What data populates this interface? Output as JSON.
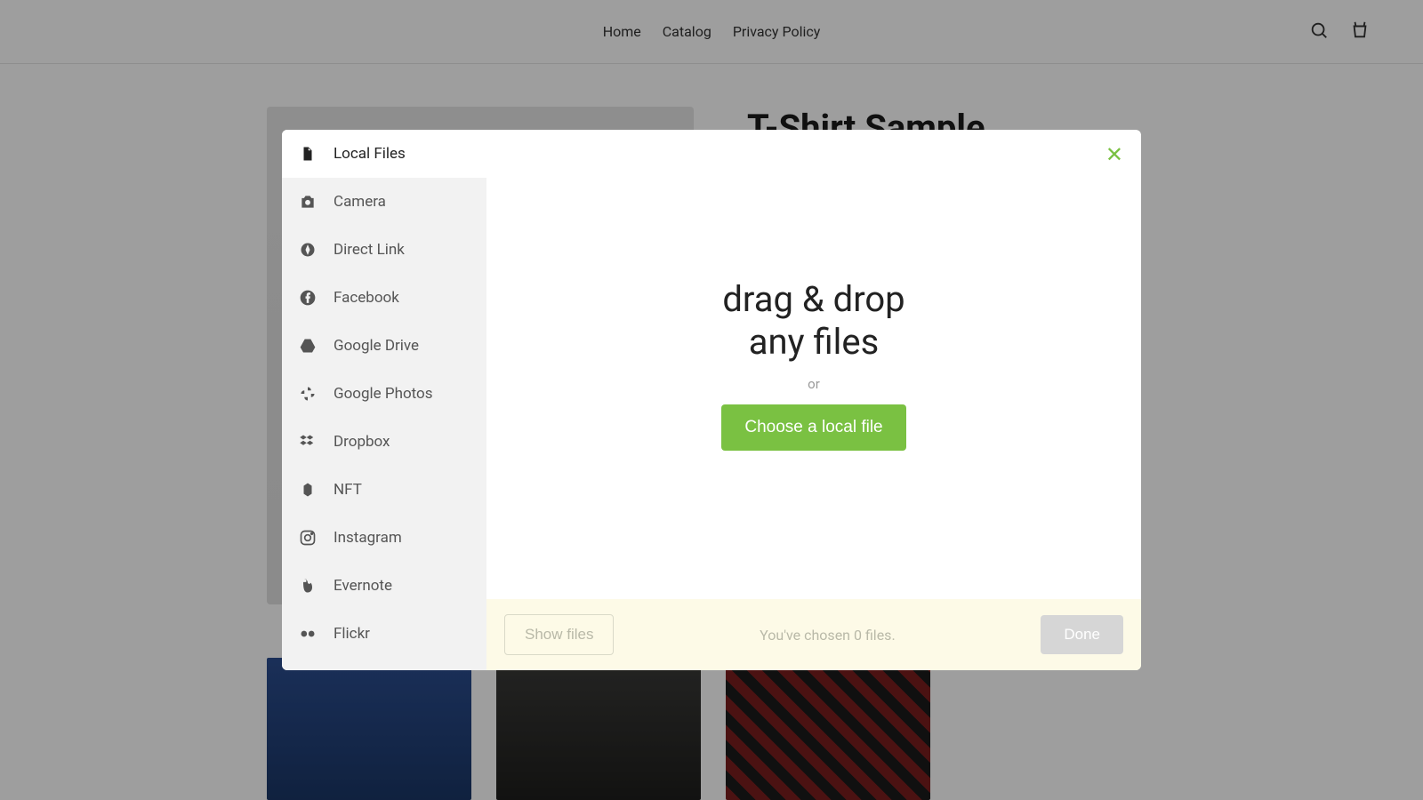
{
  "nav": {
    "home": "Home",
    "catalog": "Catalog",
    "privacy": "Privacy Policy"
  },
  "product": {
    "title": "T-Shirt Sample"
  },
  "modal": {
    "sources": [
      {
        "label": "Local Files",
        "icon": "file-icon",
        "active": true
      },
      {
        "label": "Camera",
        "icon": "camera-icon",
        "active": false
      },
      {
        "label": "Direct Link",
        "icon": "link-icon",
        "active": false
      },
      {
        "label": "Facebook",
        "icon": "facebook-icon",
        "active": false
      },
      {
        "label": "Google Drive",
        "icon": "gdrive-icon",
        "active": false
      },
      {
        "label": "Google Photos",
        "icon": "gphotos-icon",
        "active": false
      },
      {
        "label": "Dropbox",
        "icon": "dropbox-icon",
        "active": false
      },
      {
        "label": "NFT",
        "icon": "nft-icon",
        "active": false
      },
      {
        "label": "Instagram",
        "icon": "instagram-icon",
        "active": false
      },
      {
        "label": "Evernote",
        "icon": "evernote-icon",
        "active": false
      },
      {
        "label": "Flickr",
        "icon": "flickr-icon",
        "active": false
      }
    ],
    "drop_line1": "drag & drop",
    "drop_line2": "any files",
    "or": "or",
    "choose": "Choose a local file",
    "show_files": "Show files",
    "status": "You've chosen 0 files.",
    "done": "Done"
  }
}
